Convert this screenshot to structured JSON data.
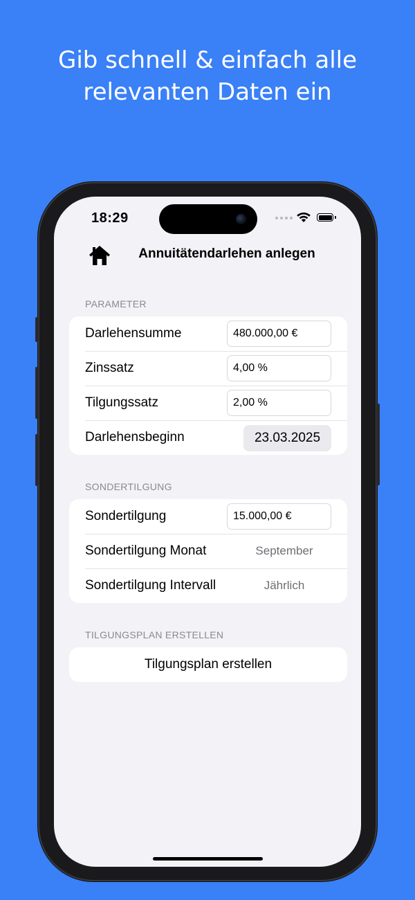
{
  "promo": {
    "headline_line1": "Gib schnell & einfach alle",
    "headline_line2": "relevanten Daten ein",
    "background_color": "#3a80f7"
  },
  "status_bar": {
    "time": "18:29",
    "icons": [
      "signal-dots-icon",
      "wifi-icon",
      "battery-icon"
    ]
  },
  "nav": {
    "home_icon": "house-icon",
    "title": "Annuitätendarlehen anlegen"
  },
  "parameter": {
    "header": "PARAMETER",
    "darlehenssumme_label": "Darlehensumme",
    "darlehenssumme_value": "480.000,00 €",
    "zinssatz_label": "Zinssatz",
    "zinssatz_value": "4,00 %",
    "tilgungssatz_label": "Tilgungssatz",
    "tilgungssatz_value": "2,00 %",
    "beginn_label": "Darlehensbeginn",
    "beginn_value": "23.03.2025"
  },
  "sondertilgung": {
    "header": "SONDERTILGUNG",
    "betrag_label": "Sondertilgung",
    "betrag_value": "15.000,00 €",
    "monat_label": "Sondertilgung Monat",
    "monat_value": "September",
    "intervall_label": "Sondertilgung Intervall",
    "intervall_value": "Jährlich"
  },
  "plan": {
    "header": "TILGUNGSPLAN ERSTELLEN",
    "button_label": "Tilgungsplan erstellen"
  }
}
